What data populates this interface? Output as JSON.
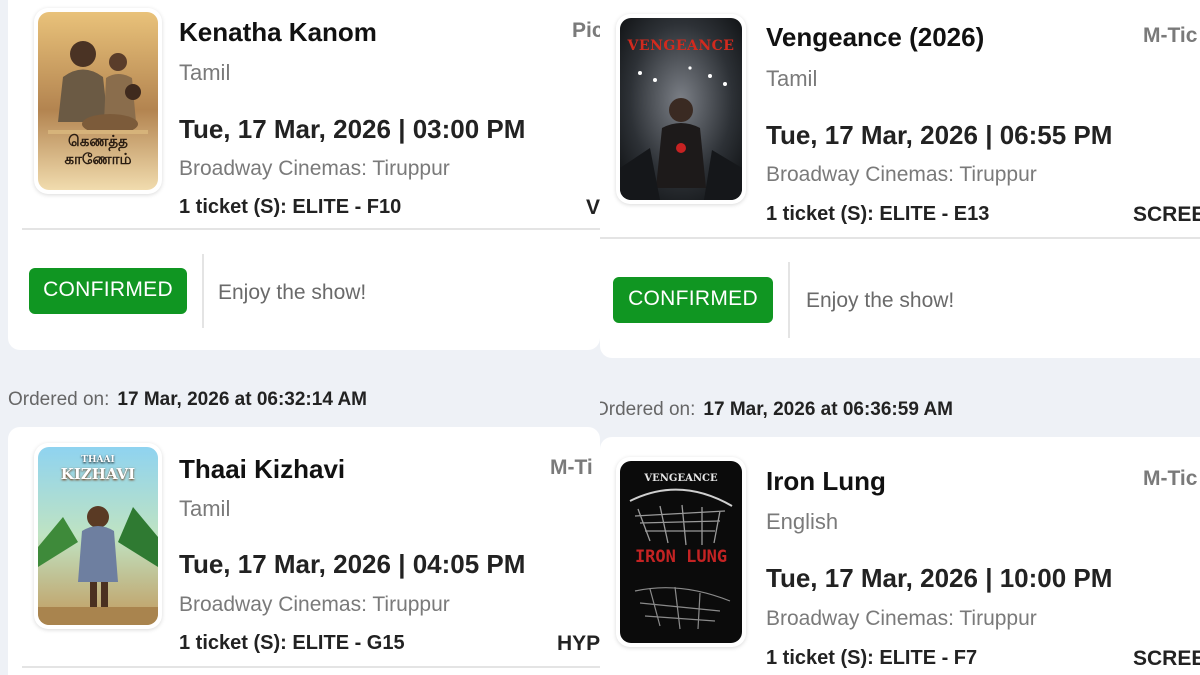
{
  "orders": [
    {
      "title": "Kenatha Kanom",
      "language": "Tamil",
      "datetime": "Tue, 17 Mar, 2026 | 03:00 PM",
      "venue": "Broadway Cinemas: Tiruppur",
      "tickets": "1 ticket (S): ELITE - F10",
      "side_top": "Pic",
      "side_bottom": "V",
      "status": "CONFIRMED",
      "message": "Enjoy the show!",
      "poster_text": "கெணத்த காணோம்"
    },
    {
      "title": "Vengeance (2026)",
      "language": "Tamil",
      "datetime": "Tue, 17 Mar, 2026 | 06:55 PM",
      "venue": "Broadway Cinemas: Tiruppur",
      "tickets": "1 ticket (S): ELITE - E13",
      "side_top": "M-Tic",
      "side_bottom": "SCREE",
      "status": "CONFIRMED",
      "message": "Enjoy the show!",
      "poster_text": "VENGEANCE"
    },
    {
      "ordered_label": "Ordered on:",
      "ordered_value": "17 Mar, 2026 at 06:32:14 AM",
      "title": "Thaai Kizhavi",
      "language": "Tamil",
      "datetime": "Tue, 17 Mar, 2026 | 04:05 PM",
      "venue": "Broadway Cinemas: Tiruppur",
      "tickets": "1 ticket (S): ELITE - G15",
      "side_top": "M-Ti",
      "side_bottom": "HYP",
      "poster_text_top": "THAAI",
      "poster_text": "KIZHAVI"
    },
    {
      "ordered_label": "Ordered on:",
      "ordered_value": "17 Mar, 2026 at 06:36:59 AM",
      "title": "Iron Lung",
      "language": "English",
      "datetime": "Tue, 17 Mar, 2026 | 10:00 PM",
      "venue": "Broadway Cinemas: Tiruppur",
      "tickets": "1 ticket (S): ELITE - F7",
      "side_top": "M-Tic",
      "side_bottom": "SCREE",
      "poster_text_top": "VENGEANCE",
      "poster_text": "IRON LUNG"
    }
  ],
  "colors": {
    "confirmed_green": "#109622",
    "page_background": "#eef1f6",
    "muted_text": "#7a7a7a"
  }
}
